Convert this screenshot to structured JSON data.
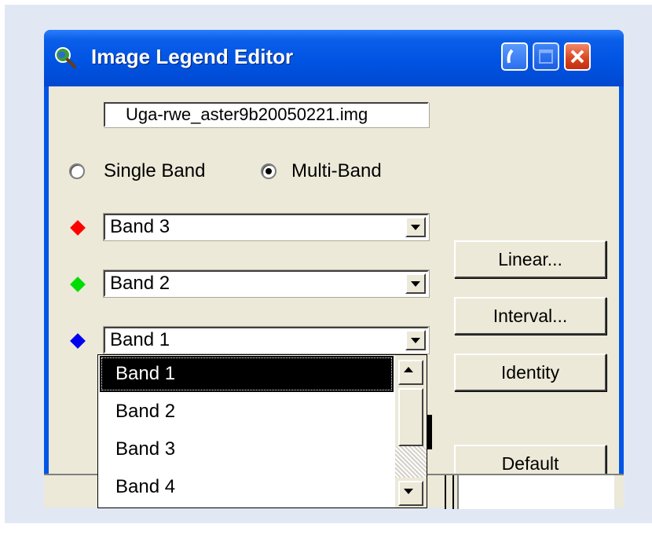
{
  "window": {
    "title": "Image Legend Editor",
    "icon": "magnifier-globe-icon"
  },
  "titlebar_buttons": {
    "minimize": "minimize-icon",
    "maximize": "maximize-icon",
    "close": "close-icon"
  },
  "file": {
    "name": "Uga-rwe_aster9b20050221.img"
  },
  "band_mode": {
    "single_label": "Single Band",
    "multi_label": "Multi-Band",
    "selected": "Multi-Band"
  },
  "bands": {
    "red": {
      "value": "Band 3",
      "color": "#ff0000"
    },
    "green": {
      "value": "Band 2",
      "color": "#00dd00"
    },
    "blue": {
      "value": "Band 1",
      "color": "#0000ee"
    }
  },
  "buttons": {
    "linear": "Linear...",
    "interval": "Interval...",
    "identity": "Identity",
    "default": "Default"
  },
  "dropdown": {
    "items": [
      "Band 1",
      "Band 2",
      "Band 3",
      "Band 4"
    ],
    "selected": "Band 1"
  },
  "colors": {
    "titlebar": "#0054e3",
    "client_bg": "#ece9d8",
    "selection_bg": "#000000"
  }
}
